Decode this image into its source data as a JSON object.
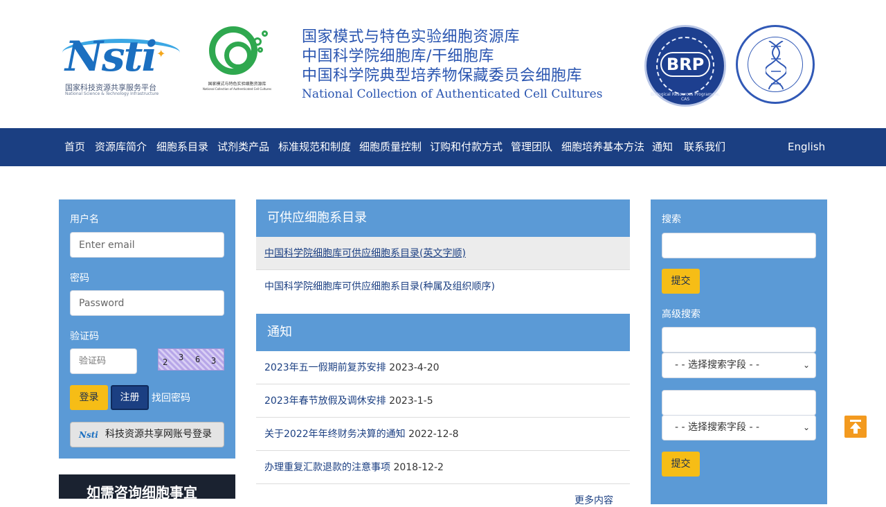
{
  "header": {
    "nsti_logo_word": "Nsti",
    "nsti_logo_cn": "国家科技资源共享服务平台",
    "nsti_logo_en": "National Science & Technology Infrastructure",
    "cell_logo_cn": "国家模式与特色实验细胞资源库",
    "cell_logo_en": "National Collection of Authenticated Cell Cultures",
    "title_lines": [
      "国家模式与特色实验细胞资源库",
      "中国科学院细胞库/干细胞库",
      "中国科学院典型培养物保藏委员会细胞库"
    ],
    "title_en": "National Collection of Authenticated Cell Cultures",
    "brp_text": "BRP",
    "brp_caption": "Biological Resources Programme, CAS"
  },
  "nav": {
    "items": [
      "首页",
      "资源库简介",
      "细胞系目录",
      "试剂类产品",
      "标准规范和制度",
      "细胞质量控制",
      "订购和付款方式",
      "管理团队",
      "细胞培养基本方法",
      "通知",
      "联系我们"
    ],
    "english": "English"
  },
  "login": {
    "username_label": "用户名",
    "username_placeholder": "Enter email",
    "password_label": "密码",
    "password_placeholder": "Password",
    "captcha_label": "验证码",
    "captcha_placeholder": "验证码",
    "captcha_chars": [
      "2",
      "3",
      "6",
      "3"
    ],
    "login_button": "登录",
    "register_button": "注册",
    "forgot_link": "找回密码",
    "nsti_login_mini": "Nsti",
    "nsti_login_button": "科技资源共享网账号登录"
  },
  "banner": {
    "text": "如需咨询细胞事宜"
  },
  "catalog": {
    "heading": "可供应细胞系目录",
    "items": [
      "中国科学院细胞库可供应细胞系目录(英文字顺)",
      "中国科学院细胞库可供应细胞系目录(种属及组织顺序)"
    ]
  },
  "notices": {
    "heading": "通知",
    "items": [
      {
        "title": "2023年五一假期前复苏安排",
        "date": "2023-4-20"
      },
      {
        "title": "2023年春节放假及调休安排",
        "date": "2023-1-5"
      },
      {
        "title": "关于2022年年终财务决算的通知",
        "date": "2022-12-8"
      },
      {
        "title": "办理重复汇款退款的注意事项",
        "date": "2018-12-2"
      }
    ],
    "more": "更多内容"
  },
  "search": {
    "label": "搜索",
    "submit": "提交",
    "advanced_label": "高级搜索",
    "select_placeholder": "- - 选择搜索字段 - -",
    "submit2": "提交"
  },
  "colors": {
    "nav_bg": "#1b3f82",
    "panel_bg": "#5b9ad6",
    "accent_yellow": "#f6bd16",
    "to_top_orange": "#f39a1f"
  }
}
